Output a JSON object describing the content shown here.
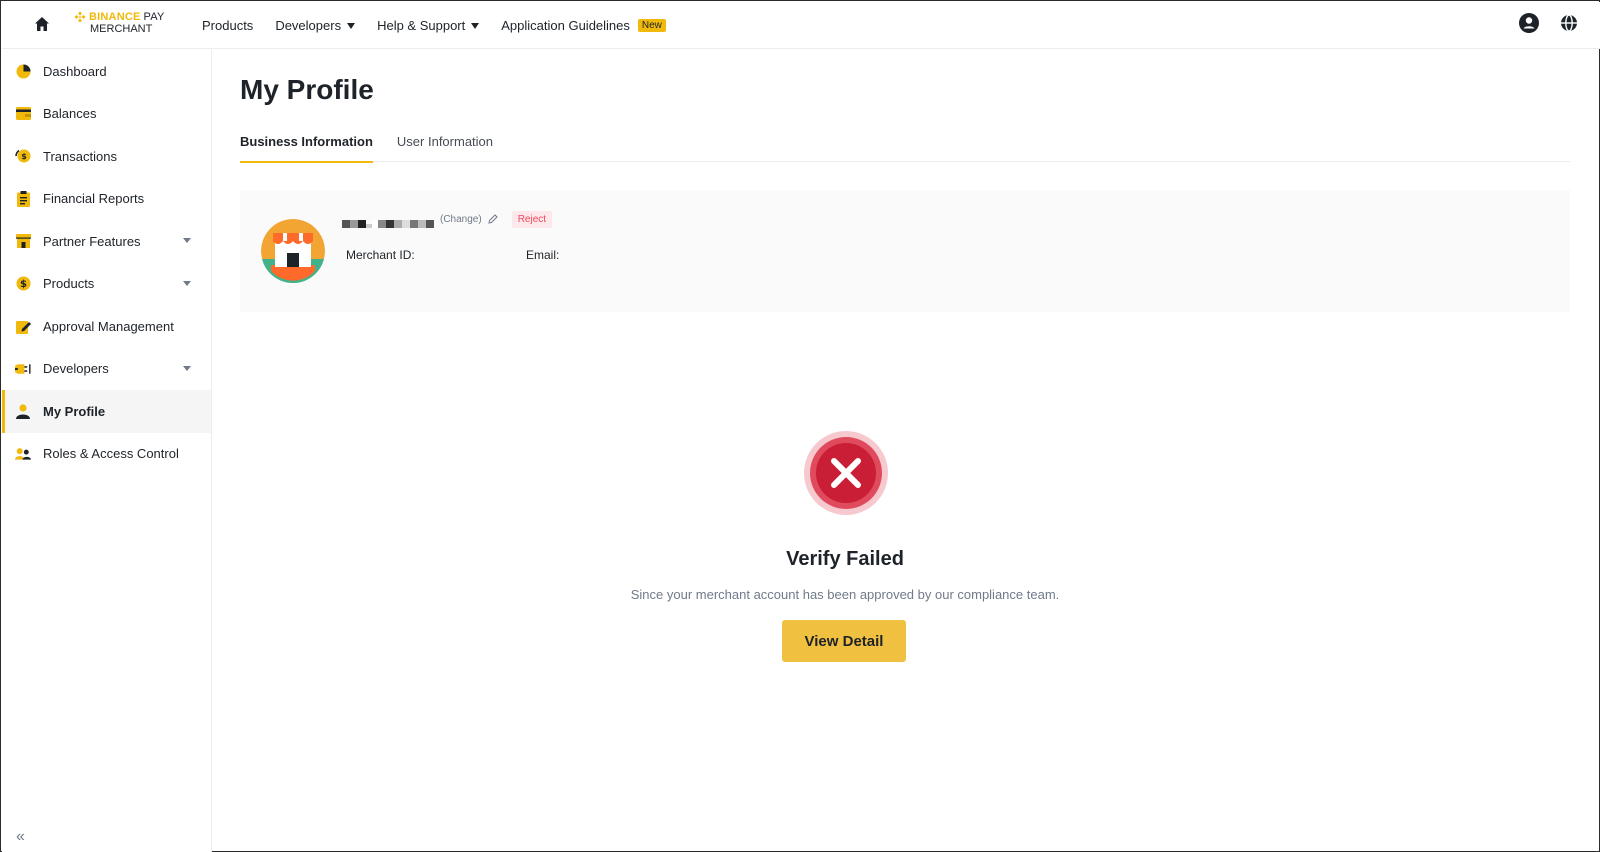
{
  "header": {
    "logo_brand": "BINANCE",
    "logo_product": "PAY",
    "logo_sub": "MERCHANT",
    "nav": [
      {
        "label": "Products",
        "has_caret": false
      },
      {
        "label": "Developers",
        "has_caret": true
      },
      {
        "label": "Help & Support",
        "has_caret": true
      },
      {
        "label": "Application Guidelines",
        "has_caret": false,
        "badge": "New"
      }
    ],
    "icons": [
      "home-icon",
      "account-icon",
      "globe-icon"
    ]
  },
  "sidebar": {
    "items": [
      {
        "label": "Dashboard",
        "icon": "dashboard-icon",
        "expandable": false
      },
      {
        "label": "Balances",
        "icon": "wallet-icon",
        "expandable": false
      },
      {
        "label": "Transactions",
        "icon": "transactions-icon",
        "expandable": false
      },
      {
        "label": "Financial Reports",
        "icon": "clipboard-icon",
        "expandable": false
      },
      {
        "label": "Partner Features",
        "icon": "store-icon",
        "expandable": true
      },
      {
        "label": "Products",
        "icon": "dollar-coin-icon",
        "expandable": true
      },
      {
        "label": "Approval Management",
        "icon": "edit-icon",
        "expandable": false
      },
      {
        "label": "Developers",
        "icon": "plug-icon",
        "expandable": true
      },
      {
        "label": "My Profile",
        "icon": "user-icon",
        "expandable": false,
        "active": true
      },
      {
        "label": "Roles & Access Control",
        "icon": "users-icon",
        "expandable": false
      }
    ],
    "collapse_label": "«"
  },
  "main": {
    "title": "My Profile",
    "tabs": [
      {
        "label": "Business Information",
        "active": true
      },
      {
        "label": "User Information",
        "active": false
      }
    ],
    "profile": {
      "change_label": "(Change)",
      "status_badge": "Reject",
      "merchant_id_label": "Merchant ID:",
      "email_label": "Email:"
    },
    "status": {
      "title": "Verify Failed",
      "description": "Since your merchant account has been approved by our compliance team.",
      "button_label": "View Detail"
    }
  },
  "colors": {
    "brand": "#f0b90b",
    "reject": "#f6465d",
    "fail_icon": "#d42a3f",
    "button": "#f0c040"
  }
}
